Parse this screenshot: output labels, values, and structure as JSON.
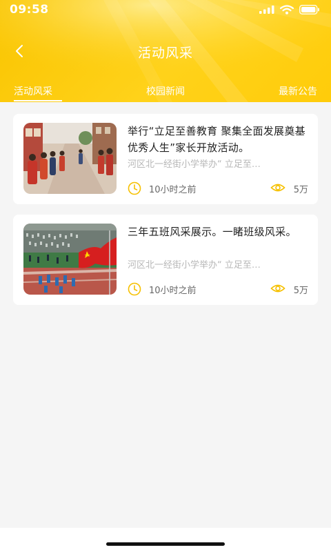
{
  "status_bar": {
    "time": "09:58"
  },
  "nav": {
    "title": "活动风采"
  },
  "tabs": [
    {
      "label": "活动风采"
    },
    {
      "label": "校园新闻"
    },
    {
      "label": "最新公告"
    }
  ],
  "cards": [
    {
      "title": "举行“立足至善教育 聚集全面发展奠基优秀人生”家长开放活动。",
      "subtitle": "河区北一经街小学举办“ 立足至…",
      "time": "10小时之前",
      "views": "5万"
    },
    {
      "title": "三年五班风采展示。一睹班级风采。",
      "subtitle": "河区北一经街小学举办“ 立足至…",
      "time": "10小时之前",
      "views": "5万"
    }
  ],
  "colors": {
    "accent": "#ffcc00",
    "icon": "#f6c000"
  }
}
